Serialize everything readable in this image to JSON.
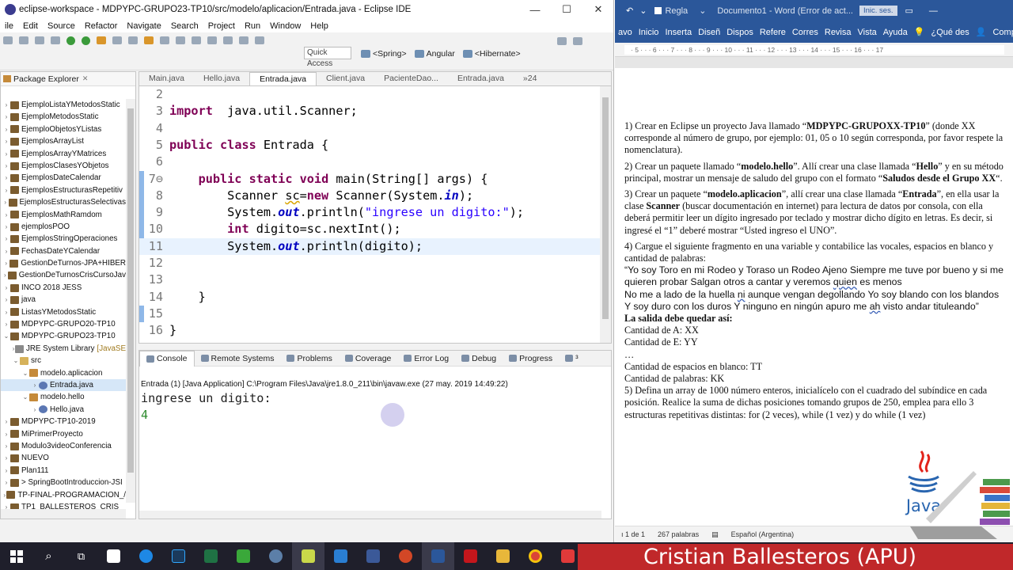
{
  "eclipse": {
    "title": "eclipse-workspace - MDPYPC-GRUPO23-TP10/src/modelo/aplicacion/Entrada.java - Eclipse IDE",
    "menu": [
      "ile",
      "Edit",
      "Source",
      "Refactor",
      "Navigate",
      "Search",
      "Project",
      "Run",
      "Window",
      "Help"
    ],
    "quick_access": "Quick Access",
    "perspectives": [
      "<Spring>",
      "Angular",
      "<Hibernate>"
    ],
    "package_explorer": {
      "title": "Package Explorer",
      "items": [
        {
          "label": "EjemploListaYMetodosStatic",
          "level": 0,
          "arrow": "›",
          "icon": "project-icon"
        },
        {
          "label": "EjemploMetodosStatic",
          "level": 0,
          "arrow": "›",
          "icon": "project-icon"
        },
        {
          "label": "EjemploObjetosYListas",
          "level": 0,
          "arrow": "›",
          "icon": "project-icon"
        },
        {
          "label": "EjemplosArrayList",
          "level": 0,
          "arrow": "›",
          "icon": "project-icon"
        },
        {
          "label": "EjemplosArrayYMatrices",
          "level": 0,
          "arrow": "›",
          "icon": "project-icon"
        },
        {
          "label": "EjemplosClasesYObjetos",
          "level": 0,
          "arrow": "›",
          "icon": "project-icon"
        },
        {
          "label": "EjemplosDateCalendar",
          "level": 0,
          "arrow": "›",
          "icon": "project-icon"
        },
        {
          "label": "EjemplosEstructurasRepetitiv",
          "level": 0,
          "arrow": "›",
          "icon": "project-icon"
        },
        {
          "label": "EjemplosEstructurasSelectivas",
          "level": 0,
          "arrow": "›",
          "icon": "project-icon"
        },
        {
          "label": "EjemplosMathRamdom",
          "level": 0,
          "arrow": "›",
          "icon": "project-icon"
        },
        {
          "label": "ejemplosPOO",
          "level": 0,
          "arrow": "›",
          "icon": "project-icon"
        },
        {
          "label": "EjemplosStringOperaciones",
          "level": 0,
          "arrow": "›",
          "icon": "project-icon"
        },
        {
          "label": "FechasDateYCalendar",
          "level": 0,
          "arrow": "›",
          "icon": "project-icon"
        },
        {
          "label": "GestionDeTurnos-JPA+HIBER",
          "level": 0,
          "arrow": "›",
          "icon": "project-icon"
        },
        {
          "label": "GestionDeTurnosCrisCursoJav",
          "level": 0,
          "arrow": "›",
          "icon": "project-icon"
        },
        {
          "label": "INCO 2018 JESS",
          "level": 0,
          "arrow": "›",
          "icon": "project-icon"
        },
        {
          "label": "java",
          "level": 0,
          "arrow": "›",
          "icon": "project-icon"
        },
        {
          "label": "ListasYMetodosStatic",
          "level": 0,
          "arrow": "›",
          "icon": "project-icon"
        },
        {
          "label": "MDPYPC-GRUPO20-TP10",
          "level": 0,
          "arrow": "›",
          "icon": "project-icon"
        },
        {
          "label": "MDPYPC-GRUPO23-TP10",
          "level": 0,
          "arrow": "⌄",
          "icon": "project-icon"
        },
        {
          "label": "JRE System Library",
          "extra": "[JavaSE",
          "level": 1,
          "arrow": "›",
          "icon": "library-icon"
        },
        {
          "label": "src",
          "level": 1,
          "arrow": "⌄",
          "icon": "folder-icon"
        },
        {
          "label": "modelo.aplicacion",
          "level": 2,
          "arrow": "⌄",
          "icon": "package-icon"
        },
        {
          "label": "Entrada.java",
          "level": 3,
          "arrow": "›",
          "icon": "java-file-icon",
          "selected": true
        },
        {
          "label": "modelo.hello",
          "level": 2,
          "arrow": "⌄",
          "icon": "package-icon"
        },
        {
          "label": "Hello.java",
          "level": 3,
          "arrow": "›",
          "icon": "java-file-icon"
        },
        {
          "label": "MDPYPC-TP10-2019",
          "level": 0,
          "arrow": "›",
          "icon": "project-icon"
        },
        {
          "label": "MiPrimerProyecto",
          "level": 0,
          "arrow": "›",
          "icon": "project-icon"
        },
        {
          "label": "Modulo3videoConferencia",
          "level": 0,
          "arrow": "›",
          "icon": "project-icon"
        },
        {
          "label": "NUEVO",
          "level": 0,
          "arrow": "›",
          "icon": "project-icon"
        },
        {
          "label": "Plan111",
          "level": 0,
          "arrow": "›",
          "icon": "project-icon"
        },
        {
          "label": "> SpringBootIntroduccion-JSI",
          "level": 0,
          "arrow": "›",
          "icon": "project-icon"
        },
        {
          "label": "TP-FINAL-PROGRAMACION_/",
          "level": 0,
          "arrow": "›",
          "icon": "project-icon"
        },
        {
          "label": "TP1_BALLESTEROS_CRIS",
          "level": 0,
          "arrow": "›",
          "icon": "project-icon"
        }
      ]
    },
    "editor": {
      "tabs": [
        {
          "label": "Main.java",
          "active": false
        },
        {
          "label": "Hello.java",
          "active": false
        },
        {
          "label": "Entrada.java",
          "active": true
        },
        {
          "label": "Client.java",
          "active": false
        },
        {
          "label": "PacienteDao...",
          "active": false
        },
        {
          "label": "Entrada.java",
          "active": false
        },
        {
          "label": "»24",
          "active": false
        }
      ],
      "lines": [
        {
          "n": "2",
          "tokens": []
        },
        {
          "n": "3",
          "tokens": [
            [
              "kw",
              "import"
            ],
            [
              "",
              "  java.util.Scanner;"
            ]
          ]
        },
        {
          "n": "4",
          "tokens": []
        },
        {
          "n": "5",
          "tokens": [
            [
              "kw",
              "public"
            ],
            [
              "",
              " "
            ],
            [
              "kw",
              "class"
            ],
            [
              "",
              " Entrada {"
            ]
          ]
        },
        {
          "n": "6",
          "tokens": []
        },
        {
          "n": "7⊖",
          "tokens": [
            [
              "",
              "    "
            ],
            [
              "kw",
              "public"
            ],
            [
              "",
              " "
            ],
            [
              "kw",
              "static"
            ],
            [
              "",
              " "
            ],
            [
              "kw",
              "void"
            ],
            [
              "",
              " main(String[] args) {"
            ]
          ]
        },
        {
          "n": "8",
          "tokens": [
            [
              "",
              "        Scanner "
            ],
            [
              "ul",
              "sc"
            ],
            [
              "",
              "="
            ],
            [
              "kw",
              "new"
            ],
            [
              "",
              " Scanner(System."
            ],
            [
              "stat",
              "in"
            ],
            [
              "",
              ");"
            ]
          ]
        },
        {
          "n": "9",
          "tokens": [
            [
              "",
              "        System."
            ],
            [
              "stat",
              "out"
            ],
            [
              "",
              ".println("
            ],
            [
              "str",
              "\"ingrese un digito:\""
            ],
            [
              "",
              ");"
            ]
          ]
        },
        {
          "n": "10",
          "tokens": [
            [
              "",
              "        "
            ],
            [
              "kw",
              "int"
            ],
            [
              "",
              " digito=sc.nextInt();"
            ]
          ]
        },
        {
          "n": "11",
          "tokens": [
            [
              "",
              "        System."
            ],
            [
              "stat",
              "out"
            ],
            [
              "",
              ".println(digito);"
            ]
          ],
          "current": true
        },
        {
          "n": "12",
          "tokens": []
        },
        {
          "n": "13",
          "tokens": []
        },
        {
          "n": "14",
          "tokens": [
            [
              "",
              "    }"
            ]
          ]
        },
        {
          "n": "15",
          "tokens": []
        },
        {
          "n": "16",
          "tokens": [
            [
              "",
              "}"
            ]
          ]
        }
      ]
    },
    "console": {
      "tabs": [
        {
          "label": "Console",
          "active": true
        },
        {
          "label": "Remote Systems",
          "active": false
        },
        {
          "label": "Problems",
          "active": false
        },
        {
          "label": "Coverage",
          "active": false
        },
        {
          "label": "Error Log",
          "active": false
        },
        {
          "label": "Debug",
          "active": false
        },
        {
          "label": "Progress",
          "active": false
        },
        {
          "label": "³",
          "active": false
        }
      ],
      "description": "Entrada (1) [Java Application] C:\\Program Files\\Java\\jre1.8.0_211\\bin\\javaw.exe (27 may. 2019 14:49:22)",
      "output_prompt": "ingrese un digito:",
      "output_input": "4"
    }
  },
  "word": {
    "title_left": "Regla",
    "title_doc": "Documento1  -  Word (Error de act...",
    "login": "Inic. ses.",
    "ribbon": [
      "avo",
      "Inicio",
      "Inserta",
      "Diseñ",
      "Dispos",
      "Refere",
      "Corres",
      "Revisa",
      "Vista",
      "Ayuda",
      "¿Qué des",
      "Compartir"
    ],
    "ruler_numbers": "· 5 · · · 6 · · · 7 · · · 8 · · · 9 · · · 10 · · · 11 · · · 12 · · · 13 · · · 14 · · · 15 · · · 16 · · · 17",
    "paragraphs": {
      "p1_a": "1) Crear en Eclipse un proyecto Java llamado “",
      "p1_b": "MDPYPC-GRUPOXX-TP10",
      "p1_c": "” (donde XX corresponde al número de grupo, por ejemplo: 01, 05 o 10 según corresponda, por favor respete la nomenclatura).",
      "p2_a": "2) Crear un paquete llamado “",
      "p2_b": "modelo.hello",
      "p2_c": "”. Allí crear una clase llamada “",
      "p2_d": "Hello",
      "p2_e": "” y en su método principal, mostrar un mensaje de saludo del grupo con el formato “",
      "p2_f": "Saludos desde el Grupo XX",
      "p2_g": "“.",
      "p3_a": "3) Crear un paquete “",
      "p3_b": "modelo.aplicacion",
      "p3_c": "”, allí crear una clase llamada “",
      "p3_d": "Entrada",
      "p3_e": "”, en ella usar la clase ",
      "p3_f": "Scanner",
      "p3_g": " (buscar documentación en internet) para lectura de datos por consola, con ella deberá permitir leer un dígito ingresado por teclado y mostrar dicho dígito en letras. Es decir, si ingresé el “1” deberé mostrar “Usted ingreso el UNO”.",
      "p4": "4) Cargue el siguiente fragmento en una variable y contabilice las vocales, espacios en blanco y cantidad de palabras:",
      "quote_1": "“Yo soy Toro en mi Rodeo y Toraso un Rodeo Ajeno Siempre me tuve por bueno y si me quieren probar Salgan otros a cantar y veremos ",
      "quote_1u": "quien",
      "quote_1e": " es menos",
      "quote_2": "No me a lado de la huella ",
      "quote_2u": "ni",
      "quote_2b": " aunque vengan degollando Yo soy blando con los blandos Y soy duro con los duros Y ninguno en ningún apuro me ",
      "quote_2u2": "ah",
      "quote_2e": " visto andar tituleando”",
      "salida": "La salida debe quedar así:",
      "cant_a": "Cantidad de A: XX",
      "cant_e": "Cantidad de E: YY",
      "dots": "…",
      "cant_esp": "Cantidad de espacios en blanco: TT",
      "cant_pal": "Cantidad de palabras: KK",
      "p5": "5) Defina un array de 1000 número enteros, inicialícelo con el cuadrado del subíndice en cada posición. Realice la suma de dichas posiciones tomando grupos de 250, emplea para ello 3 estructuras repetitivas distintas: for (2 veces), while (1 vez) y do while (1 vez)"
    },
    "status": [
      "ı 1 de 1",
      "267 palabras",
      "Español (Argentina)"
    ],
    "java_logo_text": "Java"
  },
  "banner": "Cristian Ballesteros (APU)",
  "colors": {
    "word_blue": "#2b579a",
    "banner_red": "#c0282a",
    "keyword": "#7f0055",
    "string": "#2a00ff",
    "static_field": "#0000c0",
    "console_input": "#2e8b2e",
    "taskbar": "#1f1f2b"
  }
}
